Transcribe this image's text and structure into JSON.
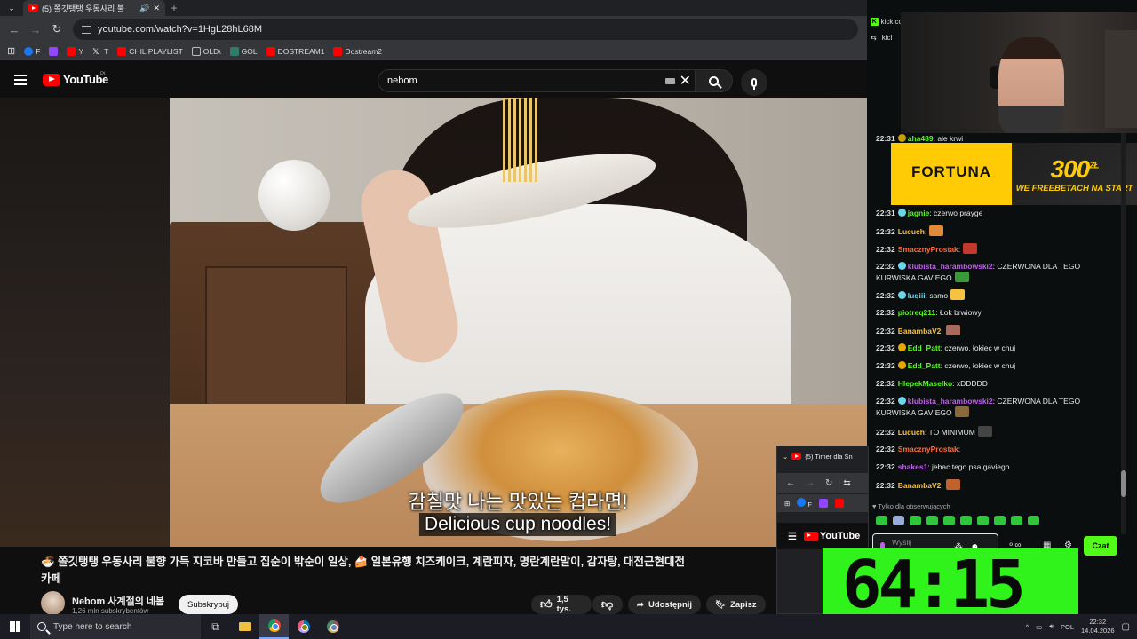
{
  "browser": {
    "active_tab_title": "(5) 쫄깃탱탱 우동사리 불",
    "url": "youtube.com/watch?v=1HgL28hL68M",
    "bookmarks": [
      {
        "label": "F",
        "color": "#1877f2"
      },
      {
        "label": "",
        "color": "#9146ff"
      },
      {
        "label": "Y",
        "color": "#ff0000"
      },
      {
        "label": "T",
        "color": "#ffffff"
      },
      {
        "label": "CHIL PLAYLIST",
        "color": "#ff0000"
      },
      {
        "label": "OLD\\",
        "color": "#888888"
      },
      {
        "label": "GOL",
        "color": "#2e7d6b"
      },
      {
        "label": "DOSTREAM1",
        "color": "#ff0000"
      },
      {
        "label": "Dostream2",
        "color": "#ff0000"
      }
    ]
  },
  "youtube": {
    "logo_text": "YouTube",
    "region": "PL",
    "search_query": "nebom",
    "subtitle_ko": "감칠맛 나는 맛있는 컵라면!",
    "subtitle_en": "Delicious cup noodles!",
    "title_line1": "🍜 쫄깃탱탱 우동사리 불향 가득 지코바 만들고 집순이 밖순이 일상, 🍰 일본유행 치즈케이크, 계란피자, 명란계란말이, 감자탕, 대전근현대전",
    "title_line2": "카페",
    "channel_name": "Nebom 사계절의 네봄",
    "channel_subs": "1,26 mln subskrybentów",
    "subscribe_label": "Subskrybuj",
    "likes": "1,5 tys.",
    "share_label": "Udostępnij",
    "save_label": "Zapisz"
  },
  "kick": {
    "tab_label": "kick.co",
    "url_label": "kicl",
    "ad_brand": "FORTUNA",
    "ad_amount": "300",
    "ad_currency": "ZŁ",
    "ad_slogan": "WE FREEBETACH NA START",
    "messages": [
      {
        "time": "22:31",
        "user": "aha489",
        "color": "#53fc18",
        "text": ": ale krwi",
        "badge": "#c8a000",
        "emote": ""
      },
      {
        "time": "22:31",
        "user": "jagnie",
        "color": "#53fc18",
        "text": ": czerwo prayge",
        "badge": "#6bd6e8",
        "emote": ""
      },
      {
        "time": "22:32",
        "user": "Lucuch",
        "color": "#f5c242",
        "text": ":",
        "badge": "",
        "emote": "#e08a3a"
      },
      {
        "time": "22:32",
        "user": "SmacznyProstak",
        "color": "#ff6b3a",
        "text": ":",
        "badge": "",
        "emote": "#c0392b"
      },
      {
        "time": "22:32",
        "user": "klubista_harambowski2",
        "color": "#c45cf2",
        "text": ": CZERWONA DLA TEGO KURWISKA GAVIEGO",
        "badge": "#6bd6e8",
        "emote": "#3a9a3a"
      },
      {
        "time": "22:32",
        "user": "luqiii",
        "color": "#6bd6e8",
        "text": ": samo",
        "badge": "#6bd6e8",
        "emote": "#f5c242"
      },
      {
        "time": "22:32",
        "user": "piotreq211",
        "color": "#53fc18",
        "text": ": Łok brwiowy",
        "badge": "",
        "emote": ""
      },
      {
        "time": "22:32",
        "user": "BanambaV2",
        "color": "#f5c242",
        "text": ":",
        "badge": "",
        "emote": "#a86a5a"
      },
      {
        "time": "22:32",
        "user": "Edd_Patt",
        "color": "#53fc18",
        "text": ": czerwo, łokiec w chuj",
        "badge": "#e8a800",
        "emote": ""
      },
      {
        "time": "22:32",
        "user": "Edd_Patt",
        "color": "#53fc18",
        "text": ": czerwo, łokiec w chuj",
        "badge": "#e8a800",
        "emote": ""
      },
      {
        "time": "22:32",
        "user": "HlepekMaselko",
        "color": "#53fc18",
        "text": ": xDDDDD",
        "badge": "",
        "emote": ""
      },
      {
        "time": "22:32",
        "user": "klubista_harambowski2",
        "color": "#c45cf2",
        "text": ": CZERWONA DLA TEGO KURWISKA GAVIEGO",
        "badge": "#6bd6e8",
        "emote": "#8a6a3a"
      },
      {
        "time": "22:32",
        "user": "Lucuch",
        "color": "#f5c242",
        "text": ":  TO MINIMUM",
        "badge": "",
        "emote": "#444444"
      },
      {
        "time": "22:32",
        "user": "SmacznyProstak",
        "color": "#ff6b3a",
        "text": ":",
        "badge": "",
        "emote": ""
      },
      {
        "time": "22:32",
        "user": "shakes1",
        "color": "#c45cf2",
        "text": ": jebac tego psa gaviego",
        "badge": "",
        "emote": ""
      },
      {
        "time": "22:32",
        "user": "BanambaV2",
        "color": "#f5c242",
        "text": ":",
        "badge": "",
        "emote": "#c0622b"
      }
    ],
    "followers_only": "Tylko dla obserwujących",
    "chat_placeholder": "Wyślij wiadomość",
    "send_label": "Czat"
  },
  "mini_window": {
    "tab_title": "(5) Timer dla Sn",
    "bookmark_f": "F",
    "yt_logo": "YouTube"
  },
  "timer": {
    "digits": "64:15"
  },
  "taskbar": {
    "search_placeholder": "Type here to search",
    "language": "POL",
    "time": "22:32",
    "date": "14.04.2026"
  },
  "colors": {
    "kick_green": "#53fc18",
    "youtube_red": "#ff0000",
    "fortuna_yellow": "#ffcb05"
  }
}
